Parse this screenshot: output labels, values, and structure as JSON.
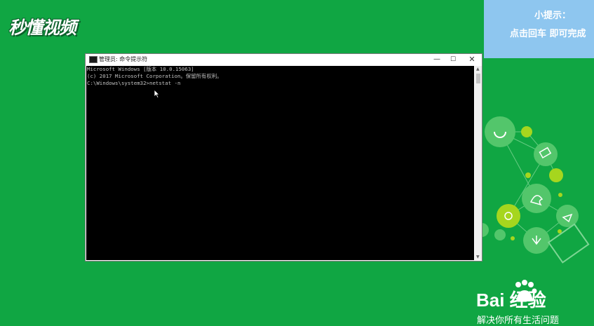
{
  "brand": {
    "logo_text": "秒懂视频"
  },
  "tip": {
    "title": "小提示：",
    "body": "点击回车  即可完成"
  },
  "window": {
    "title": "管理员: 命令提示符",
    "controls": {
      "minimize": "—",
      "maximize": "☐",
      "close": "✕"
    }
  },
  "console": {
    "lines": [
      "Microsoft Windows [版本 10.0.15063]",
      "(c) 2017 Microsoft Corporation。保留所有权利。",
      "",
      "C:\\Windows\\system32>netstat -n"
    ]
  },
  "footer": {
    "brand": "Bai 经验",
    "slogan": "解决你所有生活问题"
  },
  "colors": {
    "background": "#10a643",
    "tip_panel": "#8ec6ef",
    "console_bg": "#000000"
  },
  "icons": [
    "cmd-window-icon",
    "mouse-cursor-icon",
    "paw-icon",
    "decorative-bubble-cluster"
  ]
}
